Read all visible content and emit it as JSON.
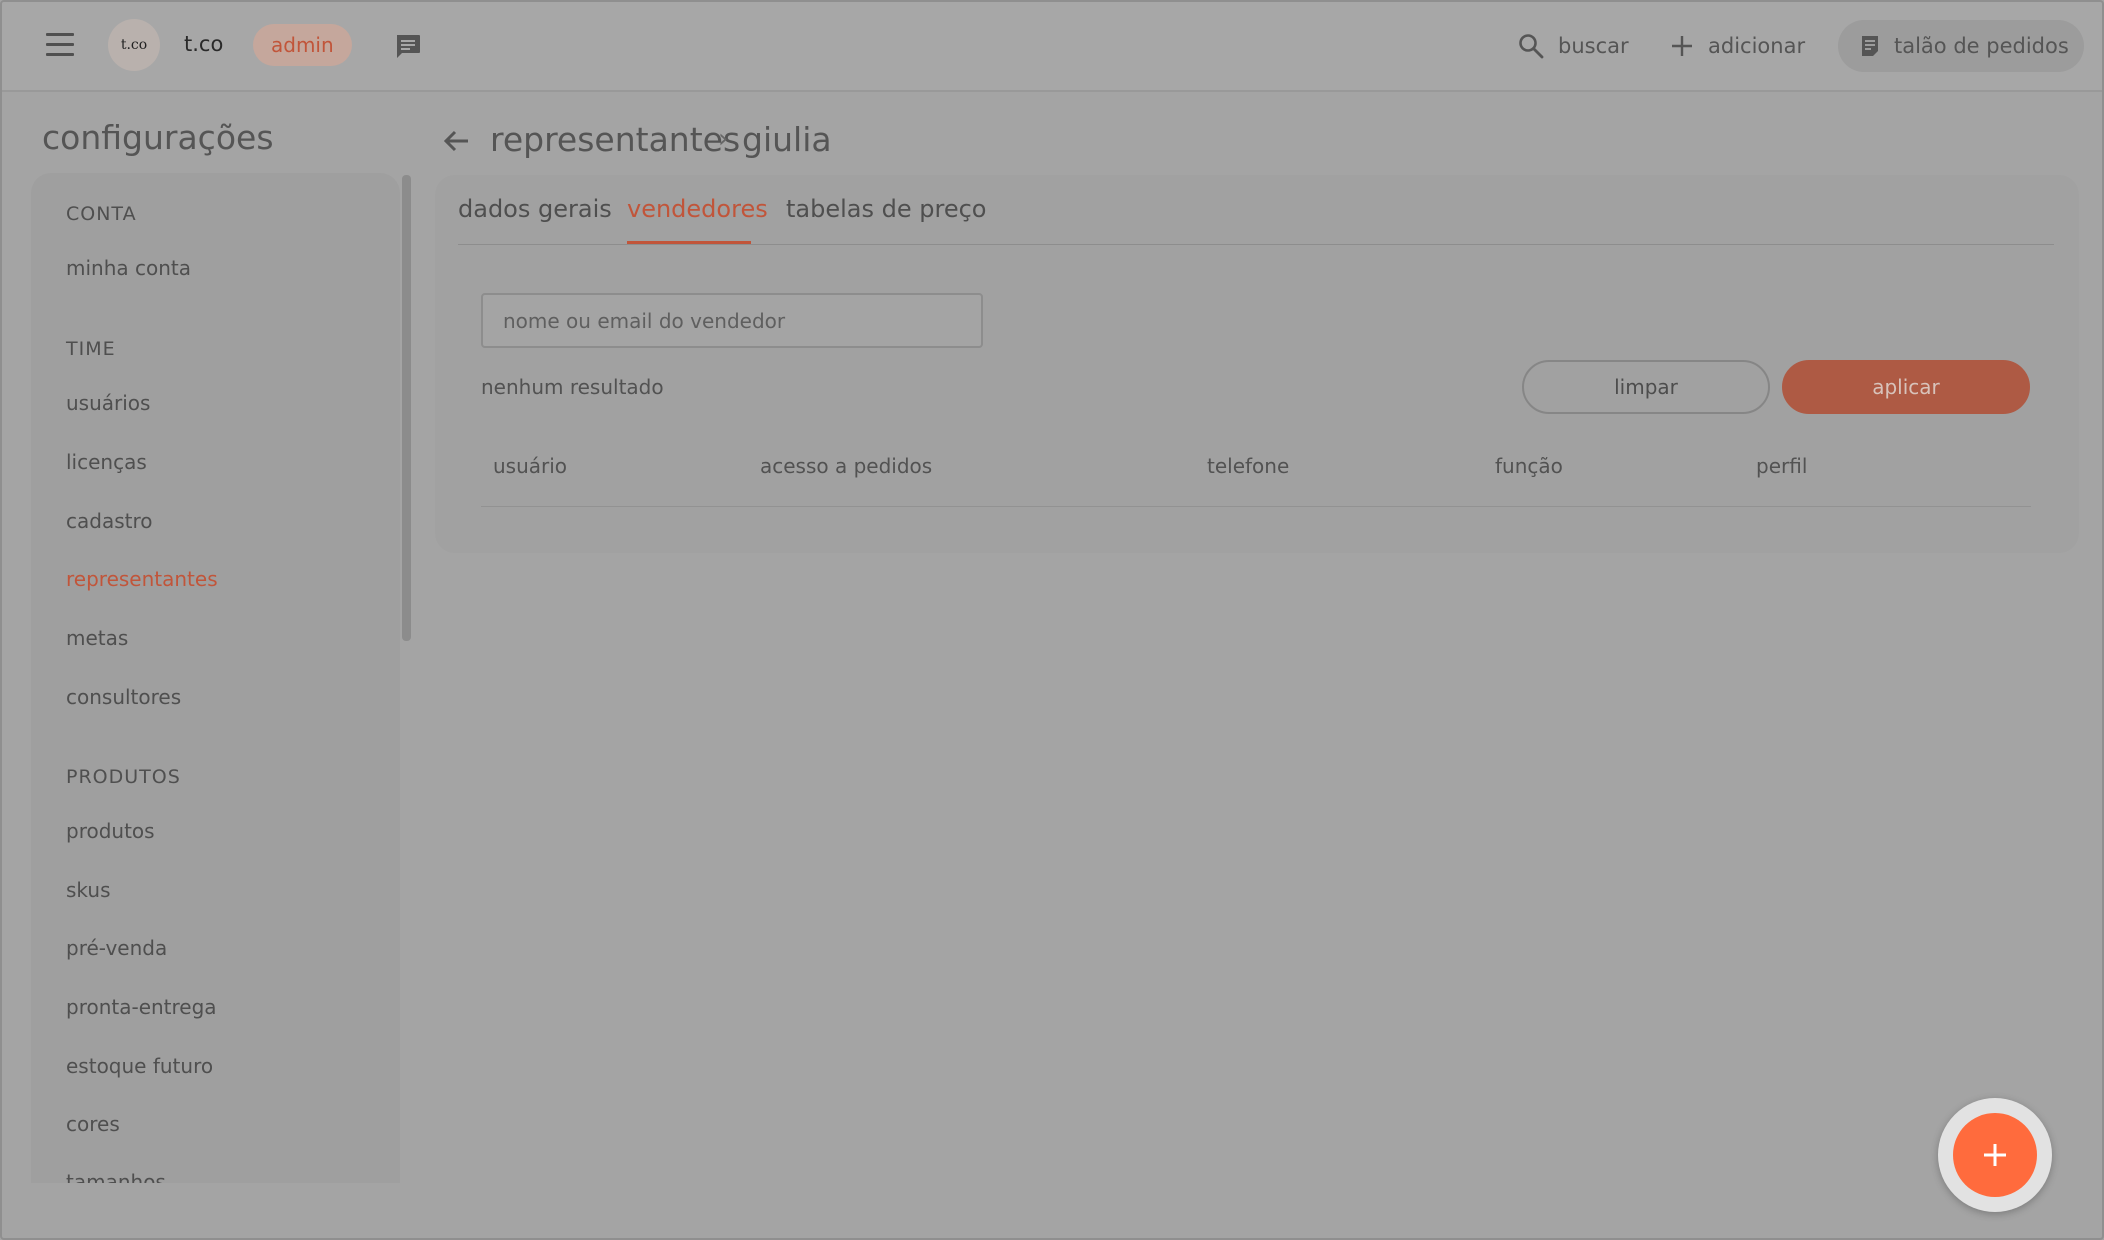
{
  "header": {
    "logo_text": "t.co",
    "brand": "t.co",
    "badge": "admin",
    "search_label": "buscar",
    "add_label": "adicionar",
    "order_label": "talão de pedidos"
  },
  "sidebar": {
    "title": "configurações",
    "sections": [
      {
        "label": "CONTA",
        "items": [
          "minha conta"
        ]
      },
      {
        "label": "TIME",
        "items": [
          "usuários",
          "licenças",
          "cadastro",
          "representantes",
          "metas",
          "consultores"
        ]
      },
      {
        "label": "PRODUTOS",
        "items": [
          "produtos",
          "skus",
          "pré-venda",
          "pronta-entrega",
          "estoque futuro",
          "cores",
          "tamanhos"
        ]
      }
    ],
    "active_item": "representantes"
  },
  "breadcrumb": {
    "parent": "representantes",
    "separator": "›",
    "current": "giulia"
  },
  "tabs": [
    {
      "label": "dados gerais"
    },
    {
      "label": "vendedores",
      "active": true
    },
    {
      "label": "tabelas de preço"
    }
  ],
  "filter": {
    "placeholder": "nome ou email do vendedor",
    "value": "",
    "status": "nenhum resultado",
    "clear_label": "limpar",
    "apply_label": "aplicar"
  },
  "table": {
    "columns": [
      "usuário",
      "acesso a pedidos",
      "telefone",
      "função",
      "perfil"
    ],
    "rows": []
  },
  "fab_label": "+",
  "colors": {
    "accent": "#c1553a",
    "fab": "#ff6b3d"
  }
}
